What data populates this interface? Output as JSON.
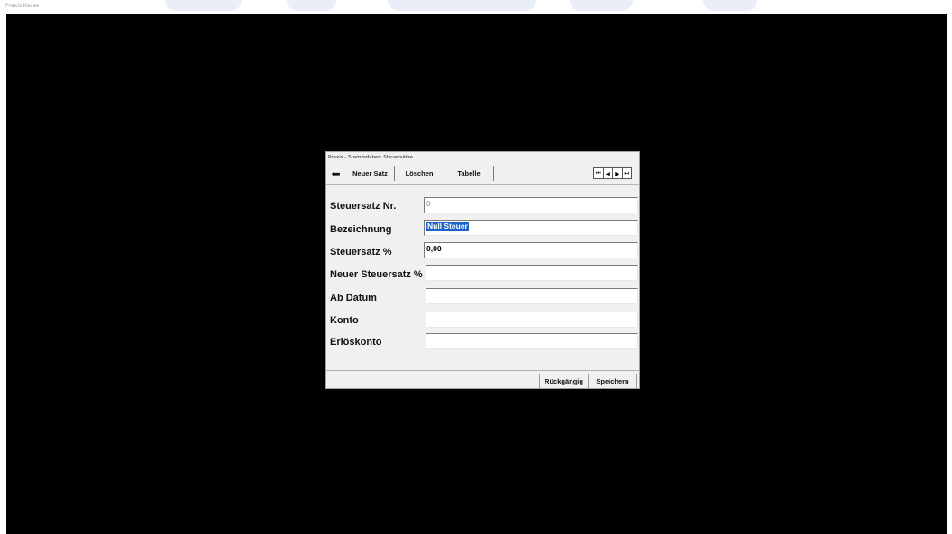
{
  "app": {
    "title": "Praxis Kasse"
  },
  "dialog": {
    "title": "Praxis - Stammdaten: Steuersätze"
  },
  "toolbar": {
    "back_icon": "arrow-left-icon",
    "new_label": "Neuer Satz",
    "delete_label": "Löschen",
    "table_label": "Tabelle",
    "nav": [
      "first-record-icon",
      "prev-record-icon",
      "next-record-icon",
      "last-record-icon"
    ]
  },
  "fields": [
    {
      "label": "Steuersatz Nr.",
      "value": "0"
    },
    {
      "label": "Bezeichnung",
      "value": "Null Steuer"
    },
    {
      "label": "Steuersatz %",
      "value": "0,00"
    },
    {
      "label": "Neuer Steuersatz %",
      "value": ""
    },
    {
      "label": "Ab Datum",
      "value": ""
    },
    {
      "label": "Konto",
      "value": ""
    },
    {
      "label": "Erlöskonto",
      "value": ""
    }
  ],
  "footer": {
    "undo_first": "R",
    "undo_rest": "ückgängig",
    "save_first": "S",
    "save_rest": "peichern"
  },
  "colors": {
    "background": "#000000",
    "dialog": "#f0f0f0",
    "selection": "#1e64c8"
  }
}
